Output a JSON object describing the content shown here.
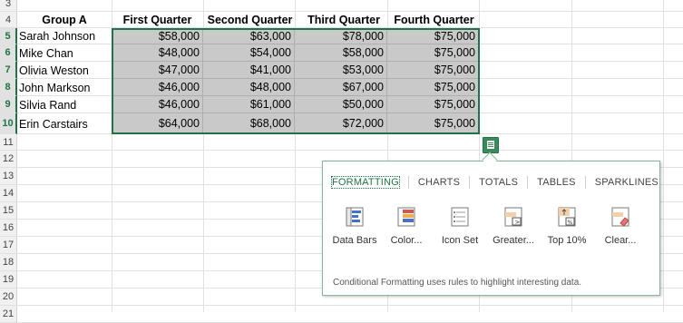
{
  "sheet": {
    "row_numbers": [
      "3",
      "4",
      "5",
      "6",
      "7",
      "8",
      "9",
      "10",
      "11",
      "12",
      "13",
      "14",
      "15",
      "16",
      "17",
      "18",
      "19",
      "20",
      "21"
    ],
    "headers": [
      "Group A",
      "First Quarter",
      "Second Quarter",
      "Third Quarter",
      "Fourth Quarter"
    ],
    "rows": [
      {
        "name": "Sarah Johnson",
        "q1": "$58,000",
        "q2": "$63,000",
        "q3": "$78,000",
        "q4": "$75,000"
      },
      {
        "name": "Mike Chan",
        "q1": "$48,000",
        "q2": "$54,000",
        "q3": "$58,000",
        "q4": "$75,000"
      },
      {
        "name": "Olivia Weston",
        "q1": "$47,000",
        "q2": "$41,000",
        "q3": "$53,000",
        "q4": "$75,000"
      },
      {
        "name": "John Markson",
        "q1": "$46,000",
        "q2": "$48,000",
        "q3": "$67,000",
        "q4": "$75,000"
      },
      {
        "name": "Silvia Rand",
        "q1": "$46,000",
        "q2": "$61,000",
        "q3": "$50,000",
        "q4": "$75,000"
      },
      {
        "name": "Erin Carstairs",
        "q1": "$64,000",
        "q2": "$68,000",
        "q3": "$72,000",
        "q4": "$75,000"
      }
    ],
    "accent_color": "#217346",
    "selection_fill": "#c9c9c9"
  },
  "quick_analysis": {
    "button_icon": "quick-analysis-icon",
    "tabs": [
      "FORMATTING",
      "CHARTS",
      "TOTALS",
      "TABLES",
      "SPARKLINES"
    ],
    "active_tab": "FORMATTING",
    "options": [
      {
        "label": "Data Bars",
        "icon": "data-bars-icon"
      },
      {
        "label": "Color...",
        "icon": "color-scale-icon"
      },
      {
        "label": "Icon Set",
        "icon": "icon-set-icon"
      },
      {
        "label": "Greater...",
        "icon": "greater-than-icon"
      },
      {
        "label": "Top 10%",
        "icon": "top-10-percent-icon"
      },
      {
        "label": "Clear...",
        "icon": "clear-format-icon"
      }
    ],
    "description": "Conditional Formatting uses rules to highlight interesting data."
  }
}
